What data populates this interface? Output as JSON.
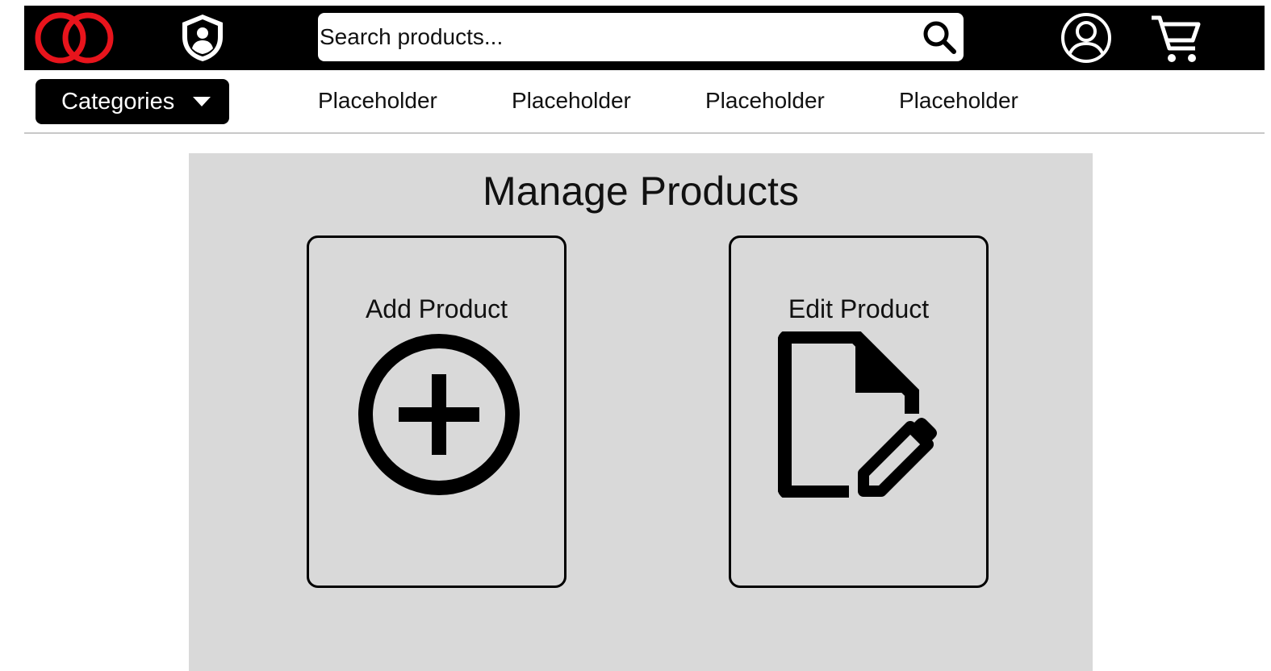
{
  "header": {
    "logo_icon": "interlocked-rings-logo",
    "admin_icon": "shield-user-icon",
    "search": {
      "placeholder": "Search products...",
      "value": ""
    },
    "search_icon": "search-icon",
    "account_icon": "user-account-icon",
    "cart_icon": "shopping-cart-icon"
  },
  "nav": {
    "categories_label": "Categories",
    "links": [
      "Placeholder",
      "Placeholder",
      "Placeholder",
      "Placeholder"
    ]
  },
  "main": {
    "title": "Manage Products",
    "cards": [
      {
        "label": "Add Product",
        "icon": "add-circle-icon"
      },
      {
        "label": "Edit Product",
        "icon": "file-edit-icon"
      }
    ]
  },
  "colors": {
    "header_bg": "#000000",
    "logo_red": "#e8141c",
    "panel_bg": "#d9d9d9",
    "button_bg": "#000000"
  }
}
